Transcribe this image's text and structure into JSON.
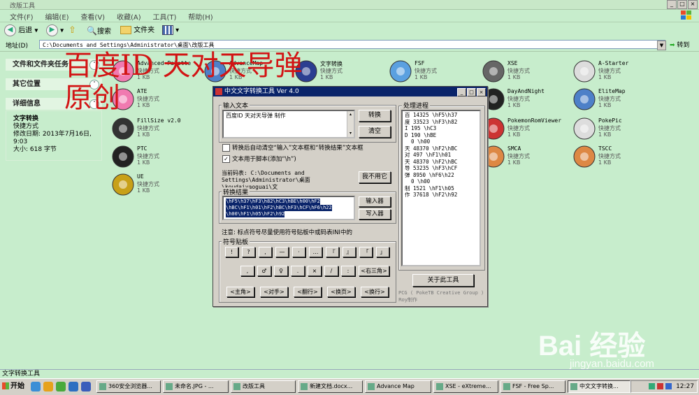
{
  "window": {
    "title": "改版工具"
  },
  "menu": [
    "文件(F)",
    "编辑(E)",
    "查看(V)",
    "收藏(A)",
    "工具(T)",
    "帮助(H)"
  ],
  "toolbar": {
    "back": "后退",
    "search": "搜索",
    "folders": "文件夹"
  },
  "address": {
    "label": "地址(D)",
    "path": "C:\\Documents and Settings\\Administrator\\桌面\\改版工具",
    "go": "转到"
  },
  "left_panel": {
    "tasks_title": "文件和文件夹任务",
    "other_title": "其它位置",
    "details_title": "详细信息",
    "details": {
      "name": "文字转换",
      "type": "快捷方式",
      "modified": "修改日期: 2013年7月16日, 9:03",
      "size": "大小: 618 字节"
    }
  },
  "overlay": {
    "line1": "百度ID 天对天导弹",
    "line2": "原创"
  },
  "files": [
    {
      "name": "Advanced Palette",
      "type": "快捷方式",
      "size": "1 KB",
      "icon": "palette-icon"
    },
    {
      "name": "AdvanceMap",
      "type": "快捷方式",
      "size": "1 KB",
      "icon": "map-icon"
    },
    {
      "name": "文字转换",
      "type": "快捷方式",
      "size": "1 KB",
      "icon": "font-convert-icon"
    },
    {
      "name": "FSF",
      "type": "快捷方式",
      "size": "1 KB",
      "icon": "magnifier-icon"
    },
    {
      "name": "XSE",
      "type": "快捷方式",
      "size": "1 KB",
      "icon": "gear-icon"
    },
    {
      "name": "A-Starter",
      "type": "快捷方式",
      "size": "1 KB",
      "icon": "pokemon-icon"
    },
    {
      "name": "ATE",
      "type": "快捷方式",
      "size": "1 KB",
      "icon": "palette-icon"
    },
    {
      "name": "DayAndNight",
      "type": "快捷方式",
      "size": "1 KB",
      "icon": "sun-icon"
    },
    {
      "name": "EliteMap",
      "type": "快捷方式",
      "size": "1 KB",
      "icon": "map-icon"
    },
    {
      "name": "FillSize v2.0",
      "type": "快捷方式",
      "size": "1 KB",
      "icon": "disc-icon"
    },
    {
      "name": "PokemonRomViewer",
      "type": "快捷方式",
      "size": "1 KB",
      "icon": "viewer-icon"
    },
    {
      "name": "PokePic",
      "type": "快捷方式",
      "size": "1 KB",
      "icon": "pokemon-icon"
    },
    {
      "name": "PTC",
      "type": "快捷方式",
      "size": "1 KB",
      "icon": "ptc-icon"
    },
    {
      "name": "SMCA",
      "type": "快捷方式",
      "size": "1 KB",
      "icon": "app-icon"
    },
    {
      "name": "TSCC",
      "type": "快捷方式",
      "size": "1 KB",
      "icon": "app-icon"
    },
    {
      "name": "UE",
      "type": "快捷方式",
      "size": "1 KB",
      "icon": "ue-icon"
    }
  ],
  "dialog": {
    "title": "中文文字转换工具  Ver 4.0",
    "input_label": "输入文本",
    "input_text": "百度ID 天对天导弹 制作",
    "convert_btn": "转换",
    "clear_btn": "清空",
    "opt1": "转换后自动清空“输入”文本框和“转换结果”文本框",
    "opt2": "文本用于脚本(添加“\\h”)",
    "codetable_label": "当前码表: C:\\Documents and Settings\\Administrator\\桌面\\koudaiyaoguai\\文",
    "not_use_btn": "我不用它",
    "result_label": "转换结果",
    "result_lines": [
      "\\hF5\\h37\\hF3\\h82\\hC3\\hBE\\h00\\hF2",
      "\\hBC\\hF1\\h01\\hF2\\hBC\\hF3\\hCF\\hF6\\h22",
      "\\h00\\hF1\\h05\\hF2\\h92"
    ],
    "import_btn": "输入器",
    "write_btn": "写入器",
    "note": "注意: 标点符号尽量使用符号贴板中或码表INI中的",
    "symbols_label": "符号贴板",
    "symbols_row1": [
      "!",
      "?",
      ",",
      "—",
      "·",
      "…",
      "『",
      "』",
      "「",
      "」"
    ],
    "symbols_row2": [
      ",",
      "♂",
      "♀",
      ".",
      "×",
      "/",
      ":",
      "<右三角>"
    ],
    "symbols_row3": [
      "<主角>",
      "<对手>",
      "<翻行>",
      "<换页>",
      "<换行>"
    ],
    "process_label": "处理进程",
    "process_lines": [
      "百 14325 \\hF5\\h37",
      "度 33523 \\hF3\\h82",
      "I 195 \\hC3",
      "D 190 \\hBE",
      "  0 \\h00",
      "天 48370 \\hF2\\hBC",
      "对 497 \\hF1\\h01",
      "天 48370 \\hF2\\hBC",
      "导 53235 \\hF3\\hCF",
      "弹 8950 \\hF6\\h22",
      "  0 \\h00",
      "制 1521 \\hF1\\h05",
      "作 37618 \\hF2\\h92"
    ],
    "close_btn": "关于此工具",
    "credit1": "PCG ( PokeTB Creative Group )",
    "credit2": "Roy制作"
  },
  "statusbar": {
    "text": "文字转换工具"
  },
  "taskbar": {
    "start": "开始",
    "tasks": [
      "360安全浏览器...",
      "未命名.JPG - ...",
      "改版工具",
      "新建文档.docx...",
      "Advance Map",
      "XSE - eXtreme...",
      "FSF - Free Sp...",
      "中文文字转换..."
    ],
    "clock": "12:27"
  },
  "watermark": {
    "logo": "Bai 经验",
    "url": "jingyan.baidu.com"
  }
}
